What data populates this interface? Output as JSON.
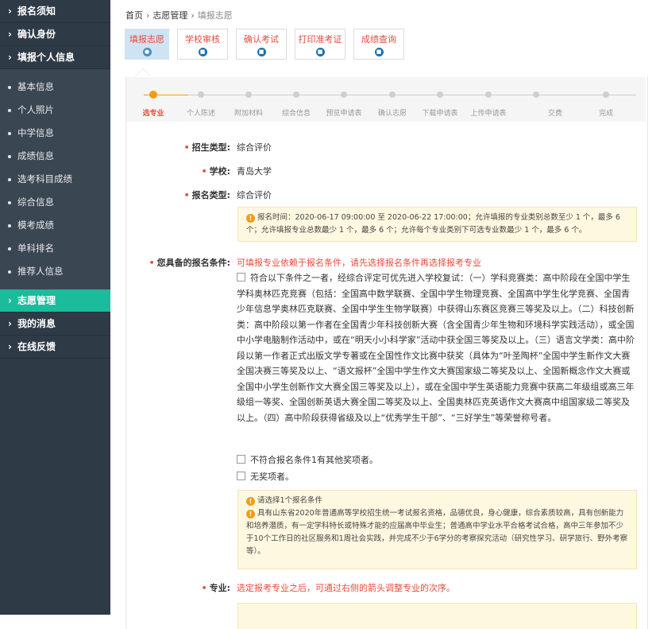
{
  "sidebar": {
    "headers": [
      "报名须知",
      "确认身份",
      "填报个人信息"
    ],
    "sub_items": [
      "基本信息",
      "个人照片",
      "中学信息",
      "成绩信息",
      "选考科目成绩",
      "综合信息",
      "模考成绩",
      "单科排名",
      "推荐人信息"
    ],
    "bottom_headers": [
      "志愿管理",
      "我的消息",
      "在线反馈"
    ]
  },
  "breadcrumb": {
    "home": "首页",
    "section": "志愿管理",
    "current": "填报志愿",
    "sep": "›"
  },
  "tabs": [
    "填报志愿",
    "学校审核",
    "确认考试",
    "打印准考证",
    "成绩查询"
  ],
  "steps": [
    "选专业",
    "个人陈述",
    "附加材料",
    "综合信息",
    "预览申请表",
    "确认志愿",
    "下载申请表",
    "上传申请表",
    "交费",
    "完成"
  ],
  "form": {
    "enroll_type_label": "招生类型:",
    "enroll_type_value": "综合评价",
    "school_label": "学校:",
    "school_value": "青岛大学",
    "apply_type_label": "报名类型:",
    "apply_type_value": "综合评价",
    "apply_note": "报名时间：2020-06-17 09:00:00 至 2020-06-22 17:00:00；允许填报的专业类别总数至少 1 个，最多 6 个；允许填报专业总数最少 1 个，最多 6 个；允许每个专业类别下可选专业数最少 1 个，最多 6 个。",
    "conditions_label": "您具备的报名条件:",
    "conditions_hint": "可填报专业依赖于报名条件，请先选择报名条件再选择报考专业",
    "option1": "符合以下条件之一者，经综合评定可优先进入学校复试：（一）学科竞赛类：高中阶段在全国中学生学科奥林匹克竞赛（包括：全国高中数学联赛、全国中学生物理竞赛、全国高中学生化学竞赛、全国青少年信息学奥林匹克联赛、全国中学生生物学联赛）中获得山东赛区竞赛三等奖及以上。（二）科技创新类：高中阶段以第一作者在全国青少年科技创新大赛（含全国青少年生物和环境科学实践活动），或全国中小学电脑制作活动中，或在“明天小小科学家”活动中获全国三等奖及以上。（三）语言文学类：高中阶段以第一作者正式出版文学专著或在全国性作文比赛中获奖（具体为“叶圣陶杯”全国中学生新作文大赛全国决赛三等奖及以上、“语文报杯”全国中学生作文大赛国家级二等奖及以上、全国新概念作文大赛或全国中小学生创新作文大赛全国三等奖及以上），或在全国中学生英语能力竞赛中获高二年级组或高三年级组一等奖、全国创新英语大赛全国二等奖及以上、全国奥林匹克英语作文大赛高中组国家级二等奖及以上。（四）高中阶段获得省级及以上“优秀学生干部”、“三好学生”等荣誉称号者。",
    "option2": "不符合报名条件1有其他奖项者。",
    "option3": "无奖项者。",
    "cond_note1": "请选择1个报名条件",
    "cond_note2": "具有山东省2020年普通高等学校招生统一考试报名资格，品德优良，身心健康，综合素质较高，具有创新能力和培养潜质，有一定学科特长或特殊才能的应届高中毕业生；普通高中学业水平合格考试合格，高中三年参加不少于10个工作日的社区服务和1周社会实践，并完成不少于6学分的考察探究活动（研究性学习、研学旅行、野外考察等）。",
    "major_label": "专业:",
    "major_hint": "选定报考专业之后，可通过右侧的箭头调整专业的次序。"
  },
  "colors": {
    "sidebar": "#2f3a47",
    "active": "#1abc9c",
    "accent": "#e74c3c",
    "step": "#f39c12"
  }
}
